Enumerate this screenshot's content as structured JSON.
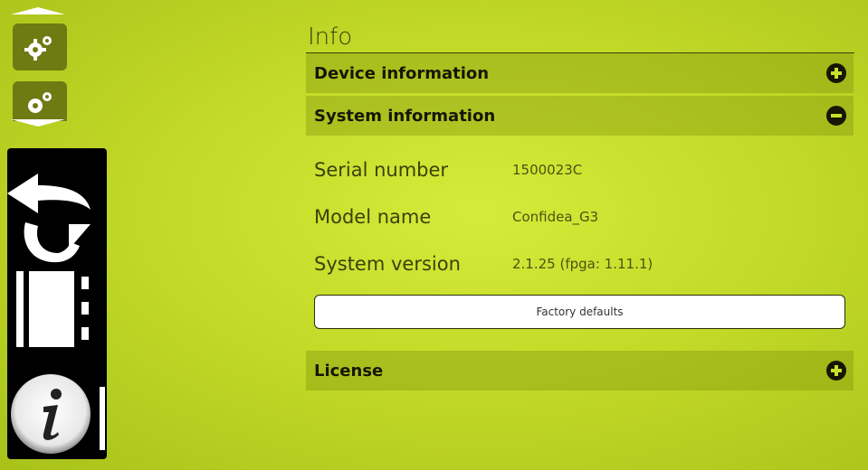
{
  "page": {
    "title": "Info"
  },
  "sections": {
    "device": {
      "title": "Device information",
      "state": "collapsed",
      "icon": "plus-circle-icon"
    },
    "system": {
      "title": "System information",
      "state": "expanded",
      "icon": "minus-circle-icon"
    },
    "license": {
      "title": "License",
      "state": "collapsed",
      "icon": "plus-circle-icon"
    }
  },
  "system_info": {
    "rows": [
      {
        "label": "Serial number",
        "value": "1500023C"
      },
      {
        "label": "Model name",
        "value": "Confidea_G3"
      },
      {
        "label": "System version",
        "value": "2.1.25 (fpga: 1.11.1)"
      }
    ],
    "factory_defaults_label": "Factory defaults"
  },
  "side_menu": {
    "items": [
      "back-arrow-icon",
      "refresh-icon",
      "io-panel-icon",
      "info-icon"
    ],
    "active": "info-icon"
  },
  "top_icons": [
    "settings-gears-icon",
    "settings-gears-icon"
  ],
  "colors": {
    "background": "#c3da28",
    "header_band": "#a7bd1d",
    "text_dark": "#141704",
    "menu": "#000000"
  }
}
